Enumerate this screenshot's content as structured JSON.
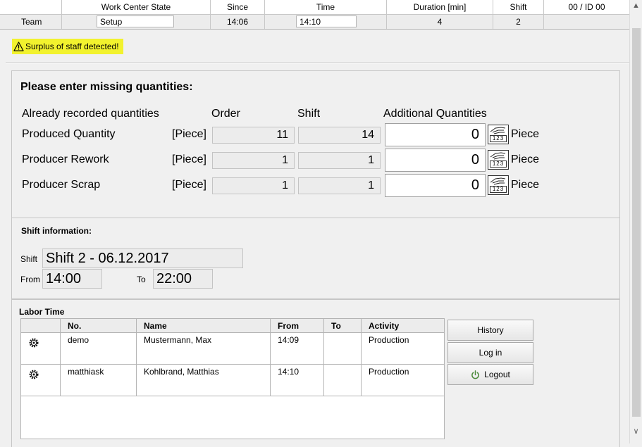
{
  "header": {
    "columns": [
      "",
      "Work Center State",
      "Since",
      "Time",
      "Duration [min]",
      "Shift",
      "00  / ID 00"
    ],
    "row": {
      "team": "Team",
      "state": "Setup",
      "since": "14:06",
      "time": "14:10",
      "duration": "4",
      "shift": "2"
    }
  },
  "warning": {
    "text": "Surplus of staff detected!",
    "icon": "warning-triangle-icon",
    "color": "#f2f22e"
  },
  "quantities": {
    "title": "Please enter missing quantities:",
    "col_recorded": "Already recorded quantities",
    "col_order": "Order",
    "col_shift": "Shift",
    "col_additional": "Additional Quantities",
    "rows": [
      {
        "label": "Produced Quantity",
        "unit": "[Piece]",
        "order": "11",
        "shift": "14",
        "additional": "0",
        "unit_after": "Piece"
      },
      {
        "label": "Producer Rework",
        "unit": "[Piece]",
        "order": "1",
        "shift": "1",
        "additional": "0",
        "unit_after": "Piece"
      },
      {
        "label": "Producer Scrap",
        "unit": "[Piece]",
        "order": "1",
        "shift": "1",
        "additional": "0",
        "unit_after": "Piece"
      }
    ],
    "keypad_icon": "hand-keypad-icon",
    "keypad_digits": "123"
  },
  "shift_info": {
    "title": "Shift information:",
    "shift_label": "Shift",
    "shift_value": "Shift 2 - 06.12.2017",
    "from_label": "From",
    "from_value": "14:00",
    "to_label": "To",
    "to_value": "22:00"
  },
  "labor": {
    "title": "Labor Time",
    "columns": [
      "",
      "No.",
      "Name",
      "From",
      "To",
      "Activity"
    ],
    "rows": [
      {
        "icon": "gear-icon",
        "no": "demo",
        "name": "Mustermann, Max",
        "from": "14:09",
        "to": "",
        "activity": "Production"
      },
      {
        "icon": "gear-icon",
        "no": "matthiask",
        "name": "Kohlbrand, Matthias",
        "from": "14:10",
        "to": "",
        "activity": "Production"
      }
    ],
    "buttons": {
      "history": "History",
      "login": "Log in",
      "logout": "Logout",
      "logout_icon": "power-icon"
    }
  }
}
